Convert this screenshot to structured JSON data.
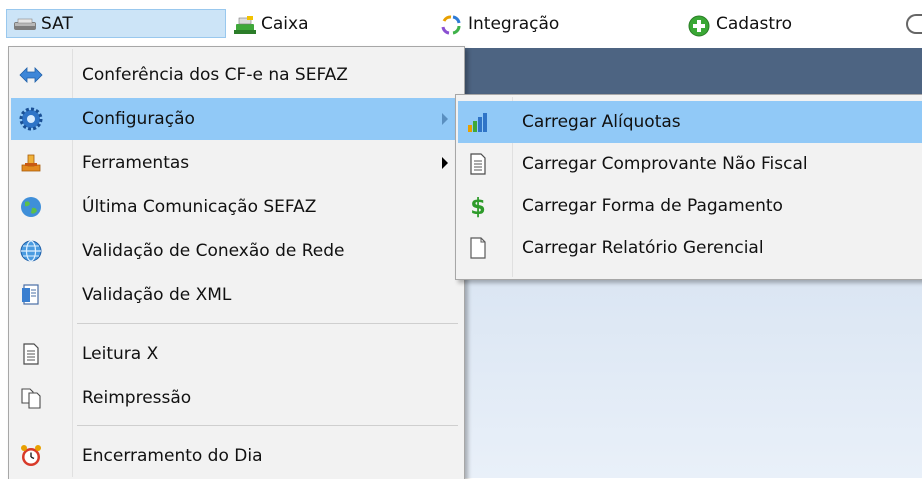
{
  "menubar": {
    "items": [
      {
        "label": "SAT",
        "icon": "sat-printer-icon"
      },
      {
        "label": "Caixa",
        "icon": "cash-register-icon"
      },
      {
        "label": "Integração",
        "icon": "integration-icon"
      },
      {
        "label": "Cadastro",
        "icon": "add-green-icon"
      }
    ]
  },
  "sat_menu": {
    "items": [
      {
        "label": "Conferência dos CF-e na SEFAZ",
        "icon": "arrows-exchange-icon"
      },
      {
        "label": "Configuração",
        "icon": "gear-icon",
        "highlighted": true,
        "submenu": true
      },
      {
        "label": "Ferramentas",
        "icon": "tools-icon",
        "submenu": true
      },
      {
        "label": "Última Comunicação SEFAZ",
        "icon": "globe-icon"
      },
      {
        "label": "Validação de Conexão de Rede",
        "icon": "network-globe-icon"
      },
      {
        "label": "Validação de XML",
        "icon": "xml-document-icon"
      },
      {
        "label": "Leitura X",
        "icon": "document-icon"
      },
      {
        "label": "Reimpressão",
        "icon": "copy-documents-icon"
      },
      {
        "label": "Encerramento do Dia",
        "icon": "alarm-clock-icon"
      }
    ]
  },
  "config_submenu": {
    "items": [
      {
        "label": "Carregar Alíquotas",
        "icon": "bar-chart-icon",
        "highlighted": true
      },
      {
        "label": "Carregar Comprovante Não Fiscal",
        "icon": "document-lines-icon"
      },
      {
        "label": "Carregar Forma de Pagamento",
        "icon": "dollar-icon"
      },
      {
        "label": "Carregar Relatório Gerencial",
        "icon": "blank-document-icon"
      }
    ]
  },
  "colors": {
    "highlight": "#91c9f7",
    "menu_bg": "#f2f2f2",
    "menubar_selected": "#cce4f7",
    "app_band": "#4d6482"
  }
}
